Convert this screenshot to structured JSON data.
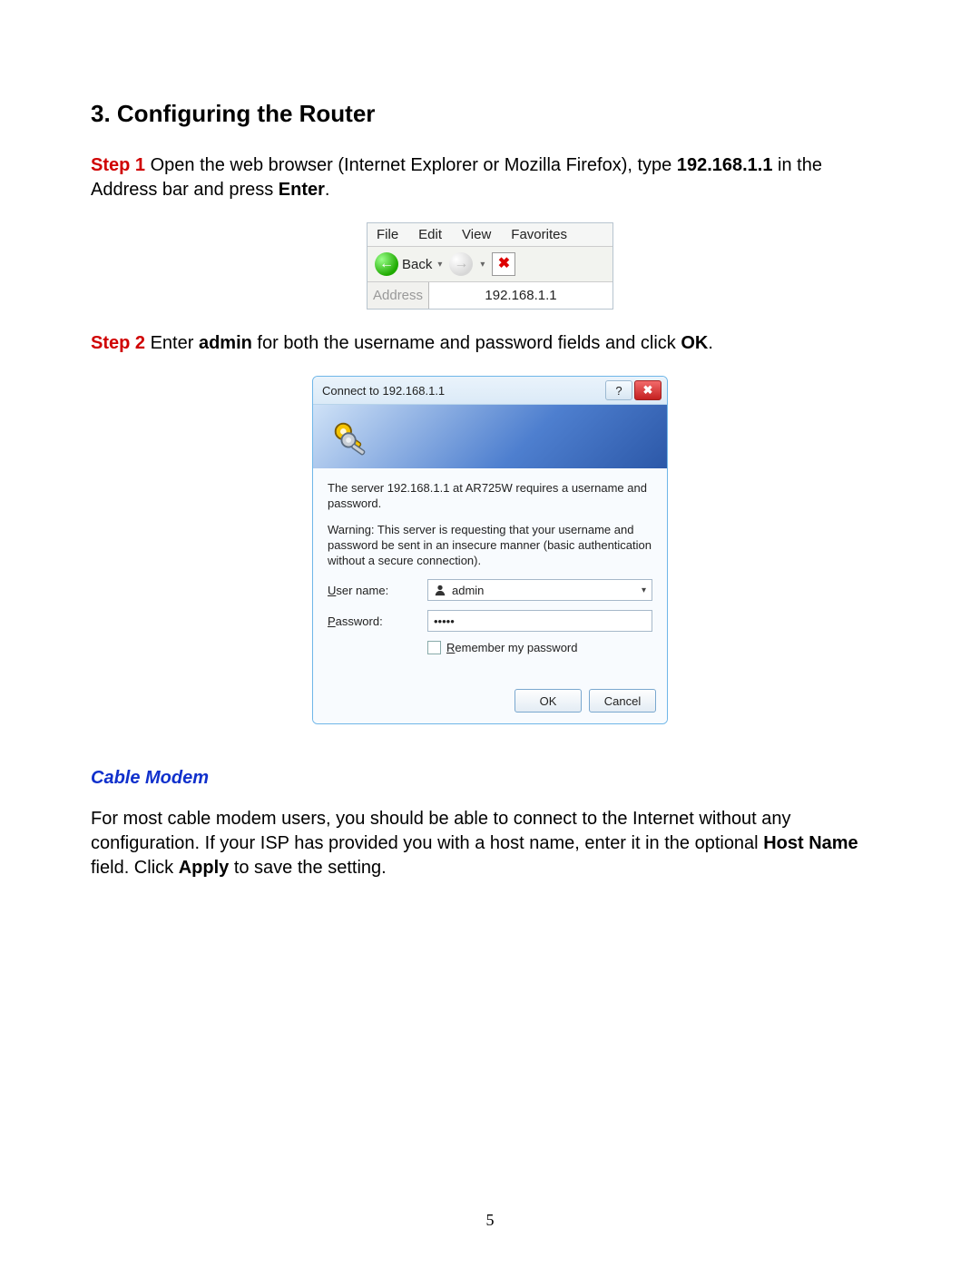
{
  "heading": "3. Configuring the Router",
  "step1": {
    "label": "Step 1",
    "pre": " Open the web browser (Internet Explorer or Mozilla Firefox), type ",
    "ip": "192.168.1.1",
    "mid": " in the Address bar and press ",
    "enter": "Enter",
    "post": "."
  },
  "browser": {
    "menu": {
      "file": "File",
      "edit": "Edit",
      "view": "View",
      "favorites": "Favorites"
    },
    "back": "Back",
    "address_label": "Address",
    "address_value": "192.168.1.1"
  },
  "step2": {
    "label": "Step 2",
    "pre": " Enter ",
    "admin": "admin",
    "mid": " for both the username and password fields and click ",
    "ok": "OK",
    "post": "."
  },
  "dialog": {
    "title": "Connect to 192.168.1.1",
    "msg1": "The server 192.168.1.1 at AR725W requires a username and password.",
    "msg2": "Warning: This server is requesting that your username and password be sent in an insecure manner (basic authentication without a secure connection).",
    "user_label_u": "U",
    "user_label_rest": "ser name:",
    "pass_label_p": "P",
    "pass_label_rest": "assword:",
    "user_value": "admin",
    "pass_value": "•••••",
    "remember_r": "R",
    "remember_rest": "emember my password",
    "ok": "OK",
    "cancel": "Cancel"
  },
  "cable": {
    "heading": "Cable Modem",
    "p1a": "For most cable modem users, you should be able to connect to the Internet without any configuration. If your ISP has provided you with a host name, enter it in the optional ",
    "hostname": "Host Name",
    "p1b": " field. Click ",
    "apply": "Apply",
    "p1c": " to save the setting."
  },
  "page_number": "5"
}
